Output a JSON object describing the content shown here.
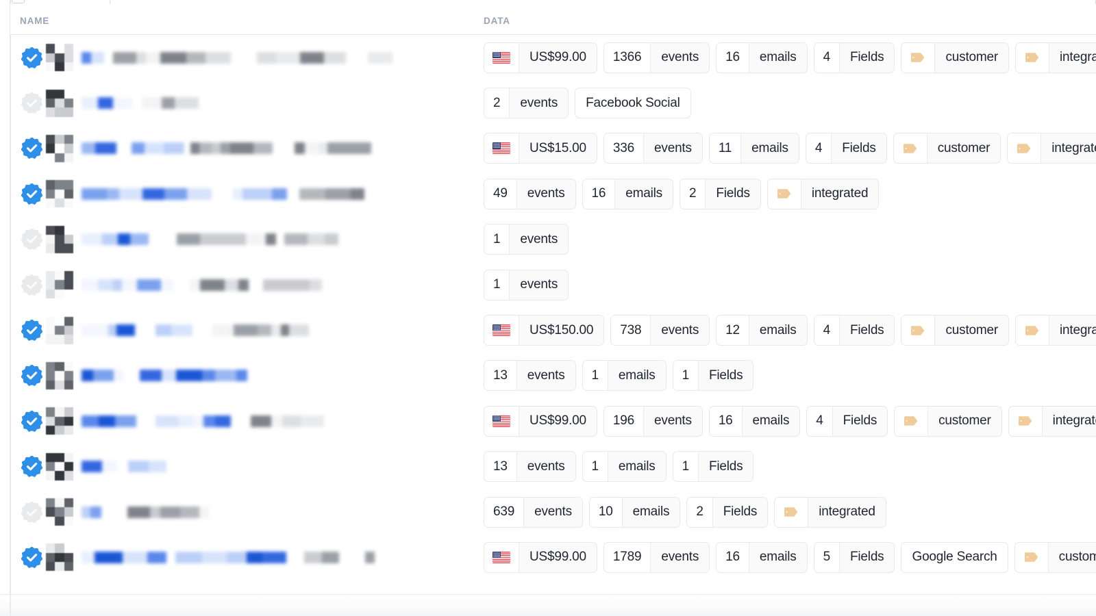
{
  "header": {
    "columns": [
      {
        "key": "name",
        "label": "NAME"
      },
      {
        "key": "data",
        "label": "DATA"
      }
    ],
    "header_text_color": "#9aa4b5"
  },
  "icons": {
    "verified_badge": "verified-check-icon",
    "unverified_badge": "unverified-check-icon",
    "flag": "us-flag-icon",
    "tag": "tag-icon",
    "checkbox": "select-all-checkbox",
    "search_field": "search-input"
  },
  "colors": {
    "verified_blue": "#2e8fe8",
    "unverified_gray": "#e9eaec",
    "chip_border": "#e6e8ec",
    "chip_value_bg": "#fafafb",
    "chip_key_bg": "#ffffff",
    "tag_tan": "#f0cc9b",
    "text": "#1f2430",
    "link_blue": "#3367e0",
    "page_bg": "#ffffff"
  },
  "labels": {
    "events": "events",
    "emails": "emails",
    "fields": "Fields"
  },
  "rows": [
    {
      "verified": true,
      "name_redacted": true,
      "chips": [
        {
          "type": "flag",
          "icon": "us-flag-icon",
          "value": "US$99.00"
        },
        {
          "type": "kv",
          "key": "1366",
          "value": "events"
        },
        {
          "type": "kv",
          "key": "16",
          "value": "emails"
        },
        {
          "type": "kv",
          "key": "4",
          "value": "Fields"
        },
        {
          "type": "tag",
          "icon": "tag-icon",
          "value": "customer"
        },
        {
          "type": "tag",
          "icon": "tag-icon",
          "value": "integrated",
          "truncated": true
        }
      ]
    },
    {
      "verified": false,
      "name_redacted": true,
      "chips": [
        {
          "type": "kv",
          "key": "2",
          "value": "events"
        },
        {
          "type": "solo",
          "value": "Facebook Social"
        }
      ]
    },
    {
      "verified": true,
      "name_redacted": true,
      "chips": [
        {
          "type": "flag",
          "icon": "us-flag-icon",
          "value": "US$15.00"
        },
        {
          "type": "kv",
          "key": "336",
          "value": "events"
        },
        {
          "type": "kv",
          "key": "11",
          "value": "emails"
        },
        {
          "type": "kv",
          "key": "4",
          "value": "Fields"
        },
        {
          "type": "tag",
          "icon": "tag-icon",
          "value": "customer"
        },
        {
          "type": "tag",
          "icon": "tag-icon",
          "value": "integrated",
          "truncated": true
        }
      ]
    },
    {
      "verified": true,
      "name_redacted": true,
      "chips": [
        {
          "type": "kv",
          "key": "49",
          "value": "events"
        },
        {
          "type": "kv",
          "key": "16",
          "value": "emails"
        },
        {
          "type": "kv",
          "key": "2",
          "value": "Fields"
        },
        {
          "type": "tag",
          "icon": "tag-icon",
          "value": "integrated"
        }
      ]
    },
    {
      "verified": false,
      "name_redacted": true,
      "chips": [
        {
          "type": "kv",
          "key": "1",
          "value": "events"
        }
      ]
    },
    {
      "verified": false,
      "name_redacted": true,
      "chips": [
        {
          "type": "kv",
          "key": "1",
          "value": "events"
        }
      ]
    },
    {
      "verified": true,
      "name_redacted": true,
      "chips": [
        {
          "type": "flag",
          "icon": "us-flag-icon",
          "value": "US$150.00"
        },
        {
          "type": "kv",
          "key": "738",
          "value": "events"
        },
        {
          "type": "kv",
          "key": "12",
          "value": "emails"
        },
        {
          "type": "kv",
          "key": "4",
          "value": "Fields"
        },
        {
          "type": "tag",
          "icon": "tag-icon",
          "value": "customer"
        },
        {
          "type": "tag",
          "icon": "tag-icon",
          "value": "integrated",
          "truncated": true
        }
      ]
    },
    {
      "verified": true,
      "name_redacted": true,
      "chips": [
        {
          "type": "kv",
          "key": "13",
          "value": "events"
        },
        {
          "type": "kv",
          "key": "1",
          "value": "emails"
        },
        {
          "type": "kv",
          "key": "1",
          "value": "Fields"
        }
      ]
    },
    {
      "verified": true,
      "name_redacted": true,
      "chips": [
        {
          "type": "flag",
          "icon": "us-flag-icon",
          "value": "US$99.00"
        },
        {
          "type": "kv",
          "key": "196",
          "value": "events"
        },
        {
          "type": "kv",
          "key": "16",
          "value": "emails"
        },
        {
          "type": "kv",
          "key": "4",
          "value": "Fields"
        },
        {
          "type": "tag",
          "icon": "tag-icon",
          "value": "customer"
        },
        {
          "type": "tag",
          "icon": "tag-icon",
          "value": "integrated",
          "truncated": true
        }
      ]
    },
    {
      "verified": true,
      "name_redacted": true,
      "chips": [
        {
          "type": "kv",
          "key": "13",
          "value": "events"
        },
        {
          "type": "kv",
          "key": "1",
          "value": "emails"
        },
        {
          "type": "kv",
          "key": "1",
          "value": "Fields"
        }
      ]
    },
    {
      "verified": false,
      "name_redacted": true,
      "chips": [
        {
          "type": "kv",
          "key": "639",
          "value": "events"
        },
        {
          "type": "kv",
          "key": "10",
          "value": "emails"
        },
        {
          "type": "kv",
          "key": "2",
          "value": "Fields"
        },
        {
          "type": "tag",
          "icon": "tag-icon",
          "value": "integrated"
        }
      ]
    },
    {
      "verified": true,
      "name_redacted": true,
      "chips": [
        {
          "type": "flag",
          "icon": "us-flag-icon",
          "value": "US$99.00"
        },
        {
          "type": "kv",
          "key": "1789",
          "value": "events"
        },
        {
          "type": "kv",
          "key": "16",
          "value": "emails"
        },
        {
          "type": "kv",
          "key": "5",
          "value": "Fields"
        },
        {
          "type": "solo",
          "value": "Google Search"
        },
        {
          "type": "tag",
          "icon": "tag-icon",
          "value": "customer",
          "truncated": true
        }
      ]
    }
  ]
}
